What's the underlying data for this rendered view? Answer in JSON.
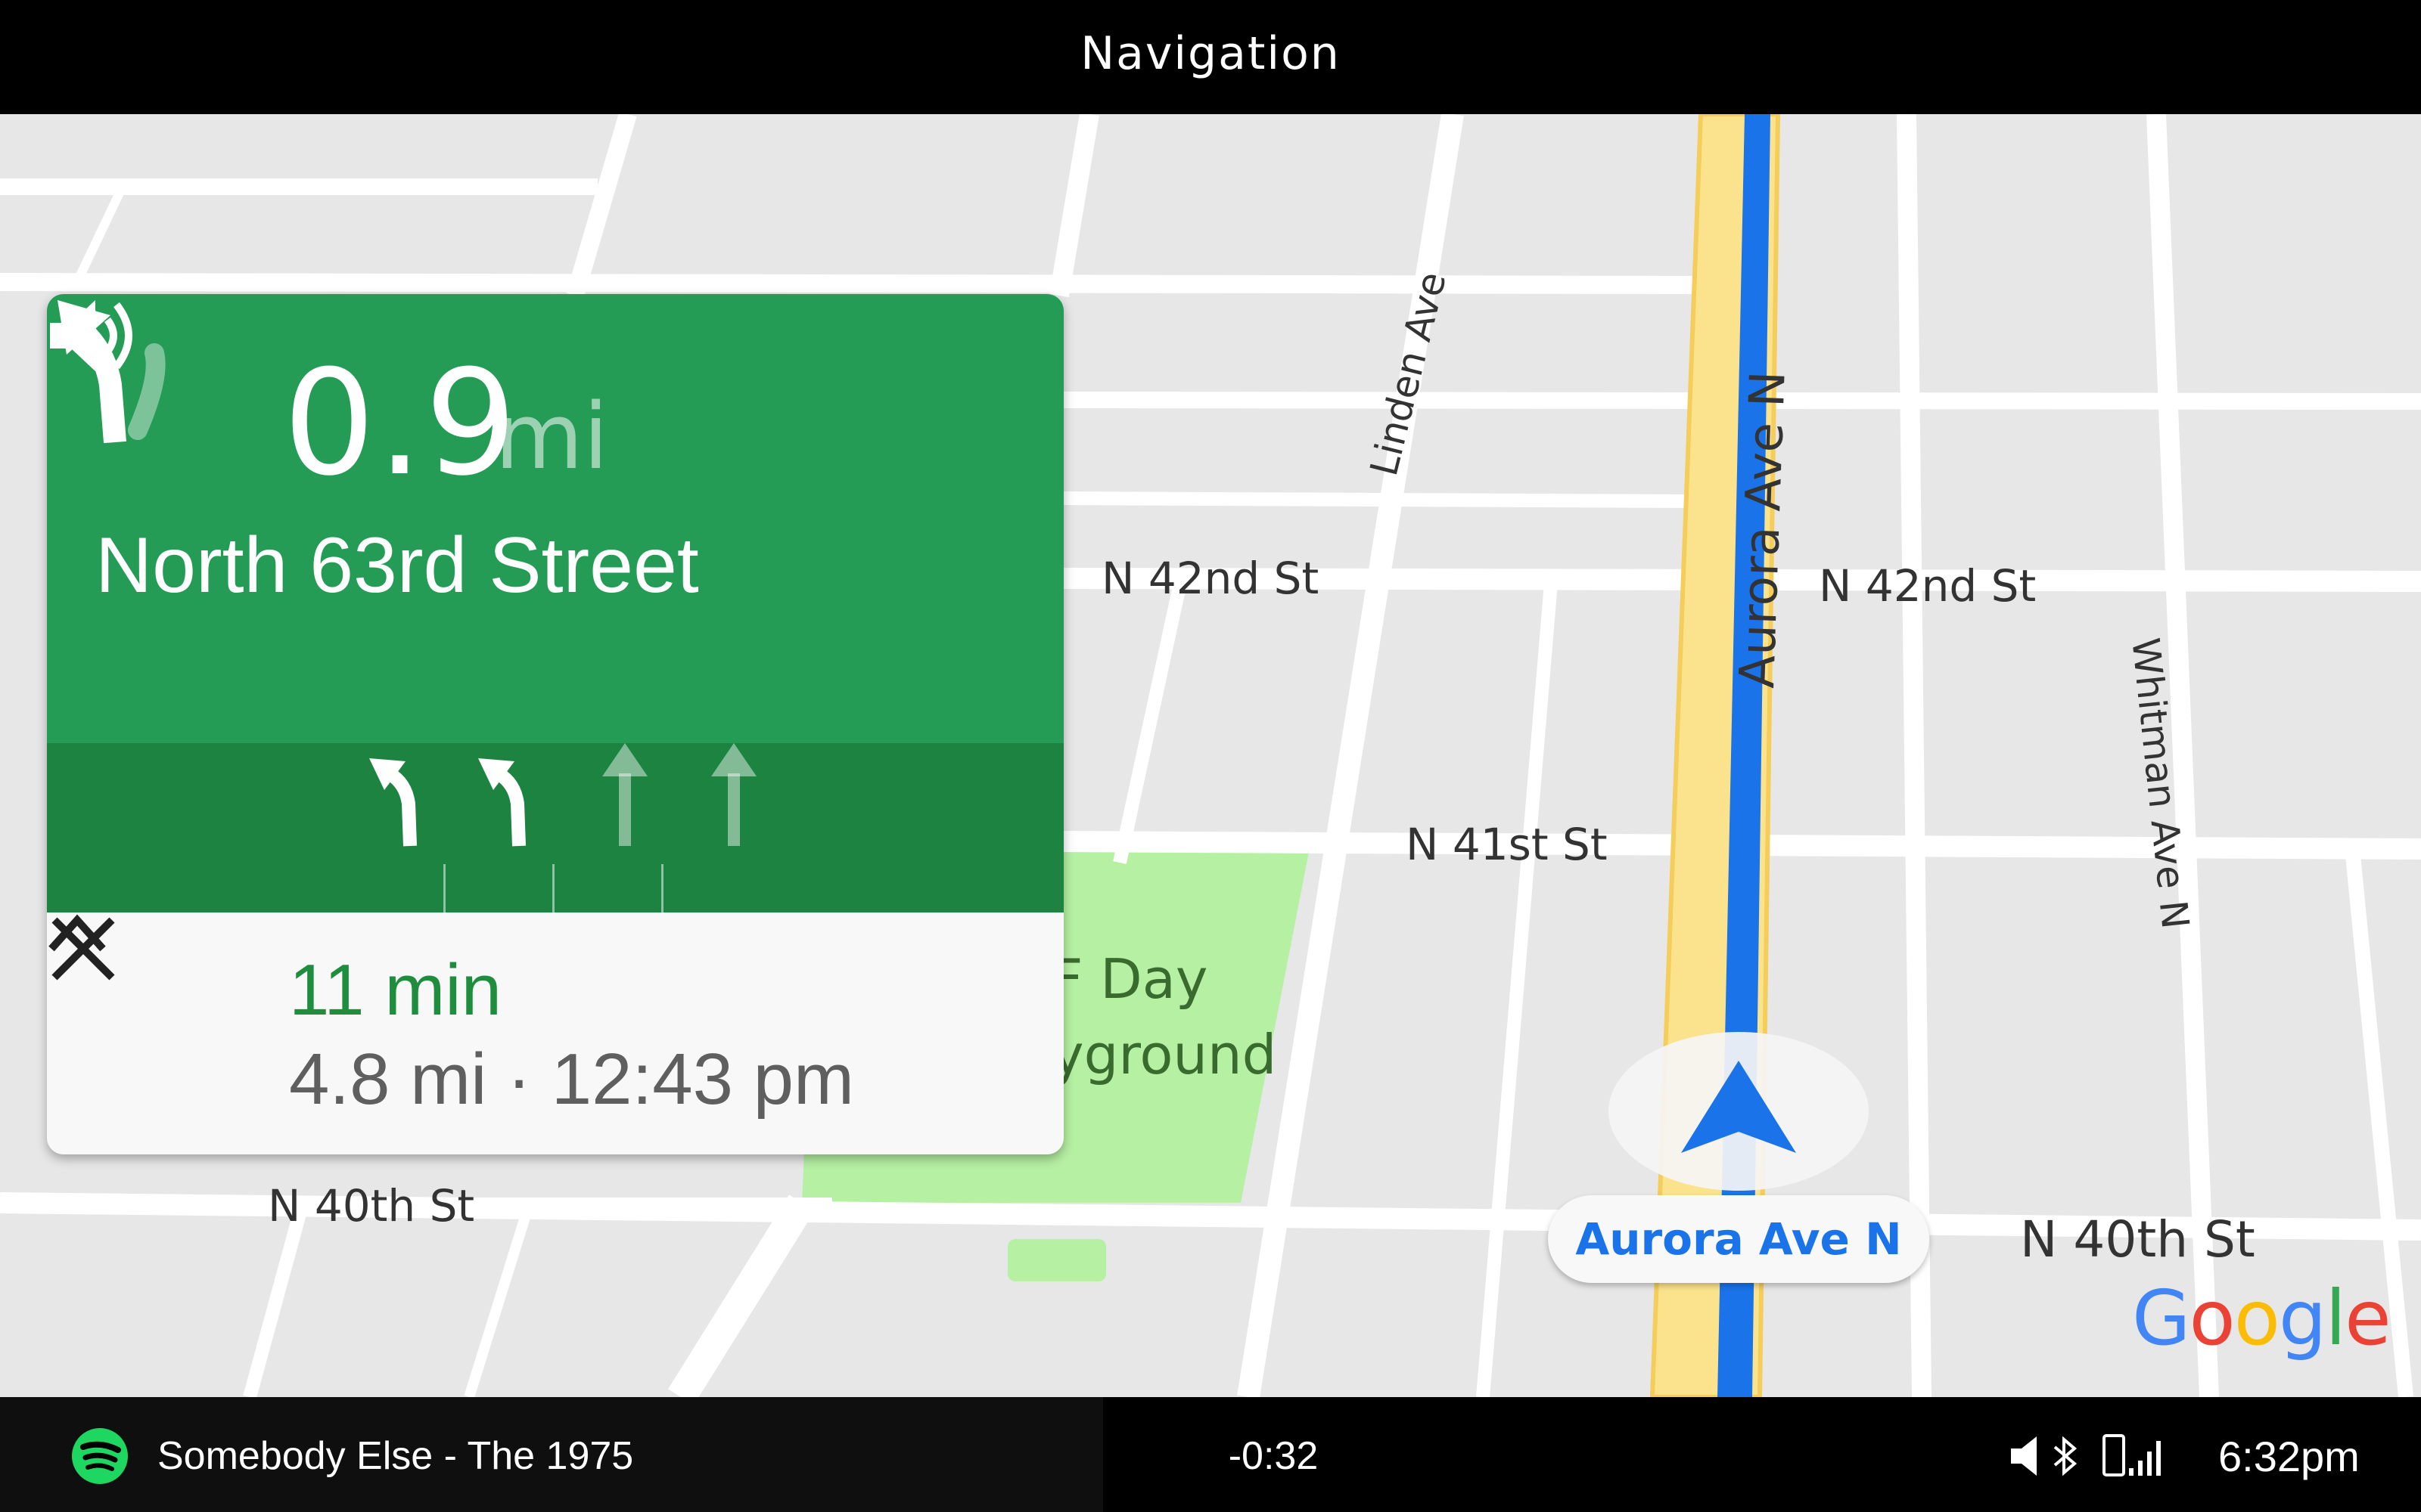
{
  "header": {
    "title": "Navigation"
  },
  "map": {
    "streets": {
      "linden_ave": "Linden Ave",
      "aurora_ave_vertical": "Aurora Ave N",
      "n42_left": "N 42nd St",
      "n42_right": "N 42nd St",
      "n41": "N 41st St",
      "whitman": "Whitman Ave N",
      "n40_left": "N 40th St",
      "n40_right": "N 40th St"
    },
    "park_label_line1": "F Day",
    "park_label_line2": "yground",
    "current_road": "Aurora Ave N",
    "attribution": "Google",
    "colors": {
      "route": "#1a73e8",
      "highway": "#fbe38e",
      "park": "#b6f0a3",
      "background": "#e7e7e7"
    }
  },
  "direction_card": {
    "maneuver_icon": "turn-slight-left-icon",
    "distance_value": "0.9",
    "distance_unit": "mi",
    "street": "North 63rd Street",
    "lanes": [
      {
        "icon": "turn-left-lane-icon",
        "active": true
      },
      {
        "icon": "turn-left-lane-icon",
        "active": true
      },
      {
        "icon": "straight-lane-icon",
        "active": false
      },
      {
        "icon": "straight-lane-icon",
        "active": false
      }
    ],
    "eta_time": "11 min",
    "eta_detail": "4.8 mi · 12:43 pm",
    "colors": {
      "primary": "#259c56",
      "lanes": "#1c8440",
      "eta": "#1e8e3e"
    }
  },
  "status_bar": {
    "track": "Somebody Else - The 1975",
    "remaining": "-0:32",
    "clock": "6:32pm",
    "icons": [
      "spotify-icon",
      "mute-icon",
      "bluetooth-icon",
      "phone-icon",
      "signal-icon"
    ]
  }
}
